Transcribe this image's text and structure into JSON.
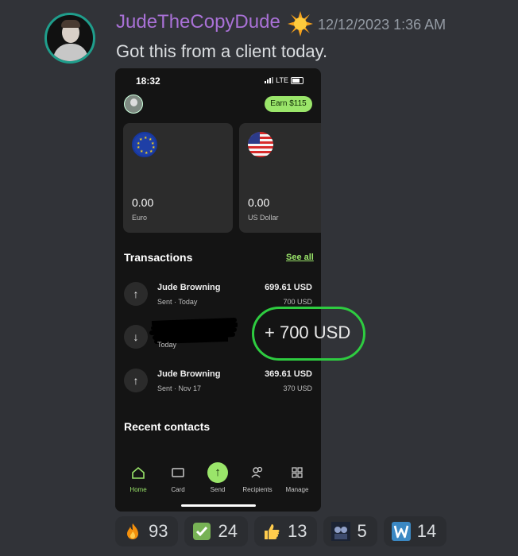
{
  "message": {
    "username": "JudeTheCopyDude",
    "timestamp": "12/12/2023 1:36 AM",
    "text": "Got this from a client today."
  },
  "phone": {
    "status_time": "18:32",
    "network": "LTE",
    "earn_label": "Earn $115",
    "cards": [
      {
        "amount": "0.00",
        "currency": "Euro",
        "flag": "eu-flag-icon"
      },
      {
        "amount": "0.00",
        "currency": "US Dollar",
        "flag": "us-flag-icon"
      }
    ],
    "transactions_title": "Transactions",
    "see_all": "See all",
    "transactions": [
      {
        "name": "Jude Browning",
        "sub": "Sent · Today",
        "amount": "699.61 USD",
        "amount_sub": "700 USD",
        "direction": "up"
      },
      {
        "name": "",
        "sub": "Today",
        "amount": "",
        "amount_sub": "",
        "direction": "down"
      },
      {
        "name": "Jude Browning",
        "sub": "Sent · Nov 17",
        "amount": "369.61 USD",
        "amount_sub": "370 USD",
        "direction": "up"
      }
    ],
    "recent_contacts": "Recent contacts",
    "nav": [
      {
        "label": "Home",
        "icon": "home-icon",
        "active": true
      },
      {
        "label": "Card",
        "icon": "card-icon",
        "active": false
      },
      {
        "label": "Send",
        "icon": "send-icon",
        "active": false
      },
      {
        "label": "Recipients",
        "icon": "recipients-icon",
        "active": false
      },
      {
        "label": "Manage",
        "icon": "manage-icon",
        "active": false
      }
    ]
  },
  "overlay": {
    "highlight_text": "+ 700 USD",
    "highlight_color": "#2ecc40"
  },
  "reactions": [
    {
      "emoji": "fire-emoji",
      "count": "93"
    },
    {
      "emoji": "check-mark-emoji",
      "count": "24"
    },
    {
      "emoji": "thumbs-up-emoji",
      "count": "13"
    },
    {
      "emoji": "custom-emoji",
      "count": "5"
    },
    {
      "emoji": "w-letter-emoji",
      "count": "14"
    }
  ],
  "colors": {
    "background": "#313338",
    "username": "#a971d6",
    "accent_green": "#9ae56a"
  }
}
